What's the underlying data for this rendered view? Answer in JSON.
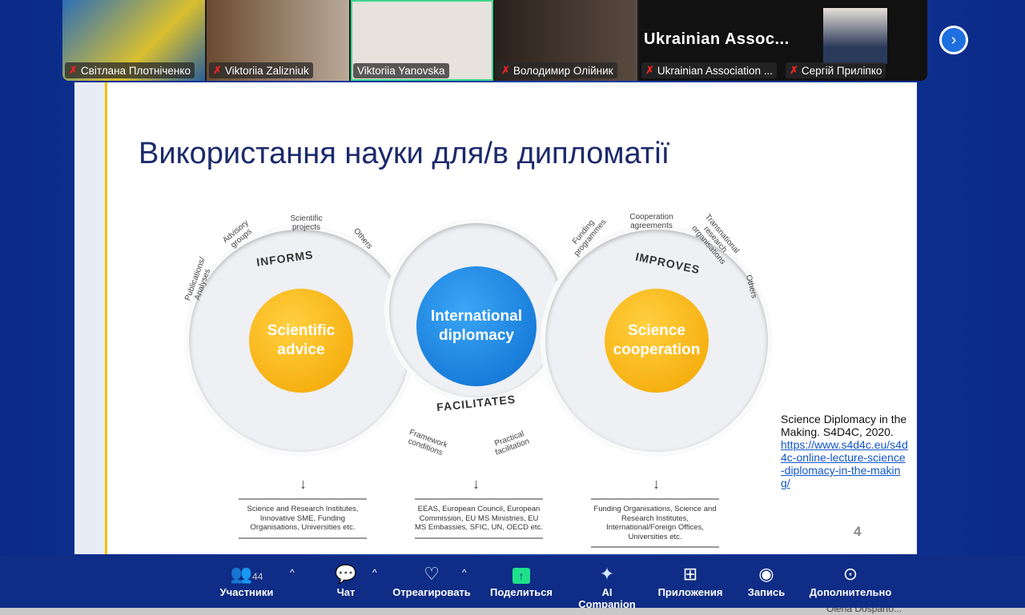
{
  "participants": [
    {
      "name": "Світлана Плотніченко",
      "muted": true,
      "bg": "#3d6fa0"
    },
    {
      "name": "Viktoriia Zalizniuk",
      "muted": true,
      "bg": "#8a7a66"
    },
    {
      "name": "Viktoriia Yanovska",
      "muted": false,
      "bg": "#e8e2dc"
    },
    {
      "name": "Володимир Олійник",
      "muted": true,
      "bg": "#3a2d28"
    },
    {
      "name": "Ukrainian Association ...",
      "muted": true,
      "display": "Ukrainian  Assoc..."
    },
    {
      "name": "Сергій Приліпко",
      "muted": true
    }
  ],
  "slide": {
    "title": "Використання науки для/в дипломатії",
    "left": {
      "center": "Scientific advice",
      "verb": "INFORMS",
      "segments": [
        "Publications/ Analyses",
        "Advisory groups",
        "Scientific projects",
        "Others"
      ],
      "targets": "Science and Research Institutes, Innovative SME, Funding Organisations, Universities etc."
    },
    "middle": {
      "center": "International diplomacy",
      "verb": "FACILITATES",
      "segments": [
        "Framework conditions",
        "Practical facilitation"
      ],
      "targets": "EEAS, European Council, European Commission, EU MS Ministries, EU MS Embassies, SFIC, UN, OECD etc."
    },
    "right": {
      "center": "Science cooperation",
      "verb": "IMPROVES",
      "segments": [
        "Funding programmes",
        "Cooperation agreements",
        "Transnational research organisations",
        "Others"
      ],
      "targets": "Funding Organisations, Science and Research Institutes, International/Foreign Offices, Universities etc."
    },
    "reference": "Science Diplomacy in the Making. S4D4C, 2020.",
    "link": "https://www.s4d4c.eu/s4d4c-online-lecture-science-diplomacy-in-the-making/",
    "page": "4"
  },
  "toolbar": {
    "participants": "Участники",
    "participants_count": "44",
    "chat": "Чат",
    "react": "Отреагировать",
    "share": "Поделиться",
    "ai": "AI Companion",
    "apps": "Приложения",
    "record": "Запись",
    "more": "Дополнительно"
  },
  "bottom_text": "Olena Dosparto..."
}
